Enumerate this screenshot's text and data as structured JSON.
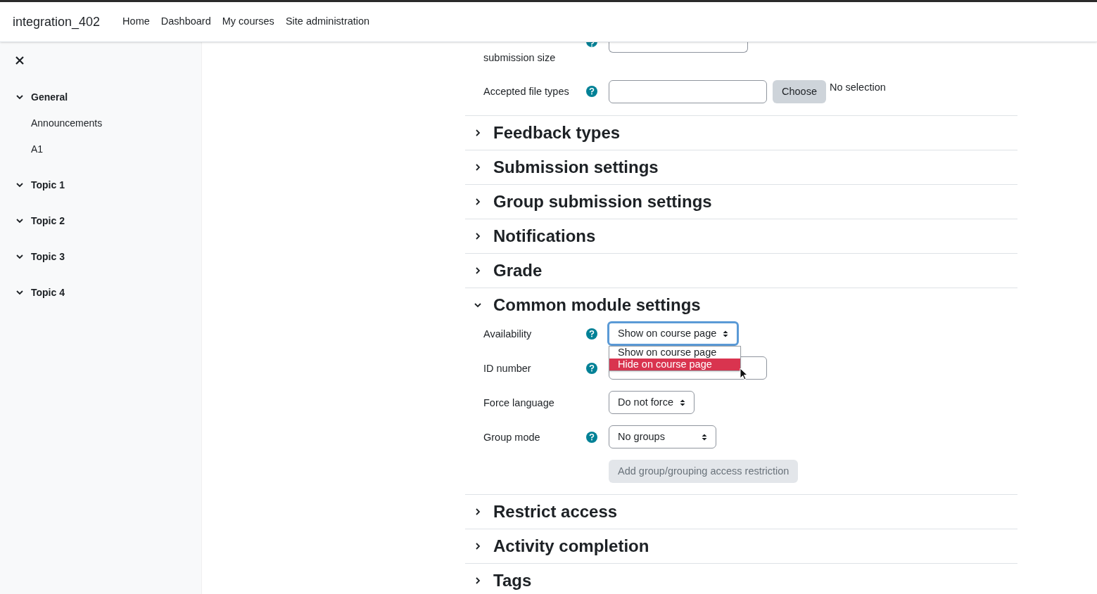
{
  "header": {
    "site_name": "integration_402",
    "nav": [
      {
        "label": "Home"
      },
      {
        "label": "Dashboard"
      },
      {
        "label": "My courses"
      },
      {
        "label": "Site administration"
      }
    ]
  },
  "drawer": {
    "items": [
      {
        "label": "General",
        "expanded": true,
        "children": [
          {
            "label": "Announcements"
          },
          {
            "label": "A1"
          }
        ]
      },
      {
        "label": "Topic 1",
        "expanded": true
      },
      {
        "label": "Topic 2",
        "expanded": true
      },
      {
        "label": "Topic 3",
        "expanded": true
      },
      {
        "label": "Topic 4",
        "expanded": true
      }
    ]
  },
  "form": {
    "top_rows": [
      {
        "kind": "cut_select",
        "label": "submission size",
        "help": true
      },
      {
        "kind": "filetypes",
        "label": "Accepted file types",
        "help": true,
        "button": "Choose",
        "status": "No selection"
      }
    ],
    "sections": [
      {
        "title": "Feedback types",
        "expanded": false
      },
      {
        "title": "Submission settings",
        "expanded": false
      },
      {
        "title": "Group submission settings",
        "expanded": false
      },
      {
        "title": "Notifications",
        "expanded": false
      },
      {
        "title": "Grade",
        "expanded": false
      },
      {
        "title": "Common module settings",
        "expanded": true,
        "fields": [
          {
            "kind": "select",
            "label": "Availability",
            "help": true,
            "value": "Show on course page",
            "focused": true,
            "options": [
              {
                "label": "Show on course page",
                "highlighted": false
              },
              {
                "label": "Hide on course page",
                "highlighted": true
              }
            ]
          },
          {
            "kind": "text",
            "label": "ID number",
            "help": true
          },
          {
            "kind": "select",
            "label": "Force language",
            "help": false,
            "value": "Do not force"
          },
          {
            "kind": "select",
            "label": "Group mode",
            "help": true,
            "value": "No groups"
          },
          {
            "kind": "button",
            "label": "Add group/grouping access restriction",
            "disabled": true
          }
        ]
      },
      {
        "title": "Restrict access",
        "expanded": false
      },
      {
        "title": "Activity completion",
        "expanded": false
      },
      {
        "title": "Tags",
        "expanded": false
      }
    ]
  }
}
